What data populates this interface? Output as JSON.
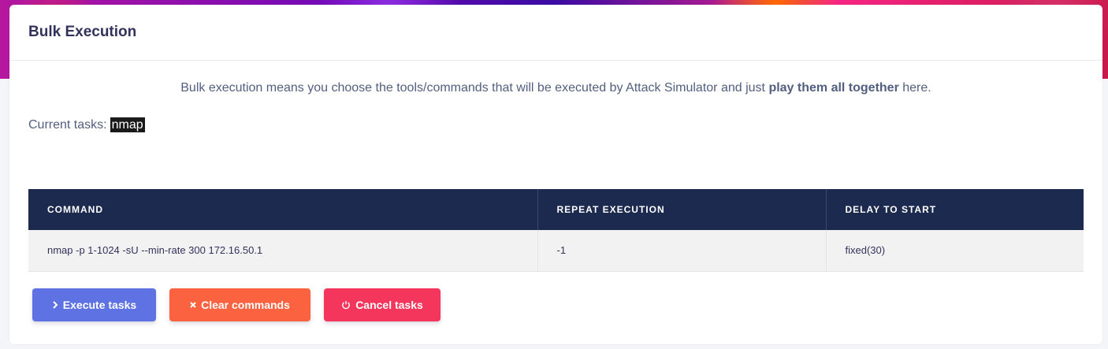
{
  "card": {
    "title": "Bulk Execution"
  },
  "intro": {
    "text_before": "Bulk execution means you choose the tools/commands that will be executed by Attack Simulator and just ",
    "text_bold": "play them all together",
    "text_after": " here."
  },
  "current_tasks": {
    "label": "Current tasks:",
    "tasks": [
      "nmap"
    ]
  },
  "table": {
    "headers": [
      "COMMAND",
      "REPEAT EXECUTION",
      "DELAY TO START"
    ],
    "rows": [
      {
        "command": "nmap -p 1-1024 -sU --min-rate 300 172.16.50.1",
        "repeat": "-1",
        "delay": "fixed(30)"
      }
    ]
  },
  "actions": {
    "execute": {
      "label": "Execute tasks",
      "icon": "chevron-right-icon",
      "color": "#5e72e4"
    },
    "clear": {
      "label": "Clear commands",
      "icon": "close-icon",
      "color": "#fb6340"
    },
    "cancel": {
      "label": "Cancel tasks",
      "icon": "power-icon",
      "color": "#f5365c"
    }
  },
  "colors": {
    "table_header": "#1b2a4e",
    "text": "#525f7f"
  }
}
